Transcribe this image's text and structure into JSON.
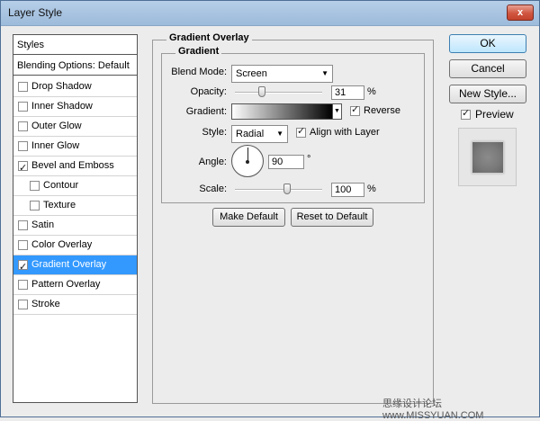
{
  "window": {
    "title": "Layer Style",
    "close_glyph": "x"
  },
  "styles_panel": {
    "header": "Styles",
    "blending_options": "Blending Options: Default",
    "items": [
      {
        "label": "Drop Shadow",
        "checked": false,
        "indent": false,
        "selected": false
      },
      {
        "label": "Inner Shadow",
        "checked": false,
        "indent": false,
        "selected": false
      },
      {
        "label": "Outer Glow",
        "checked": false,
        "indent": false,
        "selected": false
      },
      {
        "label": "Inner Glow",
        "checked": false,
        "indent": false,
        "selected": false
      },
      {
        "label": "Bevel and Emboss",
        "checked": true,
        "indent": false,
        "selected": false
      },
      {
        "label": "Contour",
        "checked": false,
        "indent": true,
        "selected": false
      },
      {
        "label": "Texture",
        "checked": false,
        "indent": true,
        "selected": false
      },
      {
        "label": "Satin",
        "checked": false,
        "indent": false,
        "selected": false
      },
      {
        "label": "Color Overlay",
        "checked": false,
        "indent": false,
        "selected": false
      },
      {
        "label": "Gradient Overlay",
        "checked": true,
        "indent": false,
        "selected": true
      },
      {
        "label": "Pattern Overlay",
        "checked": false,
        "indent": false,
        "selected": false
      },
      {
        "label": "Stroke",
        "checked": false,
        "indent": false,
        "selected": false
      }
    ]
  },
  "gradient_overlay": {
    "group_title": "Gradient Overlay",
    "subgroup_title": "Gradient",
    "blend_mode_label": "Blend Mode:",
    "blend_mode_value": "Screen",
    "opacity_label": "Opacity:",
    "opacity_value": "31",
    "opacity_unit": "%",
    "opacity_fraction": 0.31,
    "gradient_label": "Gradient:",
    "reverse_label": "Reverse",
    "reverse_checked": true,
    "style_label": "Style:",
    "style_value": "Radial",
    "align_label": "Align with Layer",
    "align_checked": true,
    "angle_label": "Angle:",
    "angle_value": "90",
    "angle_unit": "°",
    "scale_label": "Scale:",
    "scale_value": "100",
    "scale_unit": "%",
    "scale_fraction": 0.6,
    "make_default": "Make Default",
    "reset_default": "Reset to Default"
  },
  "right_panel": {
    "ok": "OK",
    "cancel": "Cancel",
    "new_style": "New Style...",
    "preview_label": "Preview",
    "preview_checked": true
  },
  "watermark": "思缘设计论坛 www.MISSYUAN.COM"
}
